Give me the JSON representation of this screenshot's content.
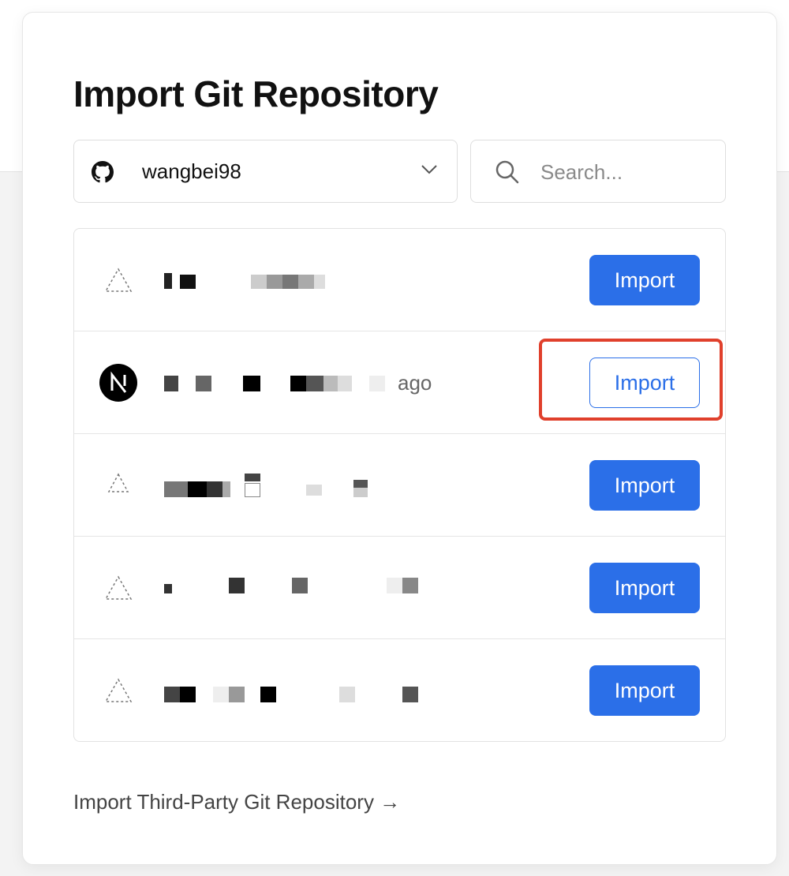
{
  "dialog": {
    "title": "Import Git Repository",
    "scope": {
      "account": "wangbei98",
      "icon": "github-icon"
    },
    "search": {
      "placeholder": "Search...",
      "value": ""
    },
    "repos": [
      {
        "name": "",
        "age": "",
        "avatar": "vercel-triangle-icon",
        "button": "Import",
        "button_style": "filled"
      },
      {
        "name": "",
        "age": "ago",
        "avatar": "nextjs-logo-icon",
        "button": "Import",
        "button_style": "outline",
        "highlighted": true
      },
      {
        "name": "",
        "age": "",
        "avatar": "vercel-triangle-icon",
        "button": "Import",
        "button_style": "filled"
      },
      {
        "name": "",
        "age": "",
        "avatar": "vercel-triangle-icon",
        "button": "Import",
        "button_style": "filled"
      },
      {
        "name": "",
        "age": "",
        "avatar": "vercel-triangle-icon",
        "button": "Import",
        "button_style": "filled"
      }
    ],
    "third_party_link": "Import Third-Party Git Repository →"
  },
  "colors": {
    "primary": "#2b6fe8",
    "highlight": "#e0402c",
    "text": "#111111",
    "muted": "#666666"
  }
}
